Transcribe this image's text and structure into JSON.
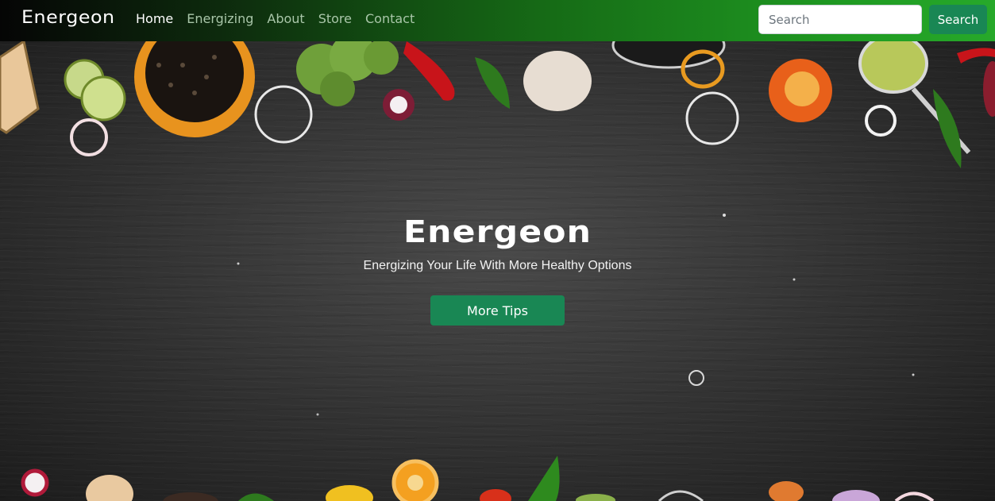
{
  "navbar": {
    "brand": "Energeon",
    "links": [
      {
        "label": "Home",
        "active": true
      },
      {
        "label": "Energizing",
        "active": false
      },
      {
        "label": "About",
        "active": false
      },
      {
        "label": "Store",
        "active": false
      },
      {
        "label": "Contact",
        "active": false
      }
    ],
    "search": {
      "placeholder": "Search",
      "value": ""
    },
    "search_button": "Search"
  },
  "hero": {
    "title": "Energeon",
    "subtitle": "Energizing Your Life With More Healthy Options",
    "cta_label": "More Tips",
    "background": "dark chalkboard with vegetables and spices"
  },
  "colors": {
    "primary": "#198754",
    "nav_gradient_start": "#050505",
    "nav_gradient_end": "#27a92a",
    "nav_link_inactive": "#a9c6a9",
    "text_light": "#ffffff"
  }
}
